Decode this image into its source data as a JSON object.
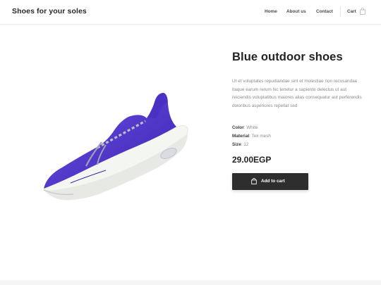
{
  "header": {
    "brand": "Shoes for your soles",
    "nav": {
      "home": "Home",
      "about": "About us",
      "contact": "Contact",
      "cart": "Cart"
    },
    "cart_icon": "shopping-bag-icon"
  },
  "product": {
    "title": "Blue outdoor shoes",
    "description": "Ut et voluptates repudiandae sint et molestiae non recusandae itaque earum rerum hic tenetur a sapiente delectus ut aut reiciendis voluptatibus maiores alias consequatur aut perferendis doloribus asperiores repellat sed",
    "specs": {
      "color_label": "Color",
      "color_value": ": White",
      "material_label": "Material",
      "material_value": ": Tek mesh",
      "size_label": "Size",
      "size_value": ": 12"
    },
    "price": "29.00EGP",
    "image": "blue-sneaker-image",
    "shoe_color": "#5b3fd0"
  },
  "add_to_cart": {
    "label": "Add to cart",
    "icon": "shopping-bag-icon",
    "bg": "#2e2e2e"
  }
}
